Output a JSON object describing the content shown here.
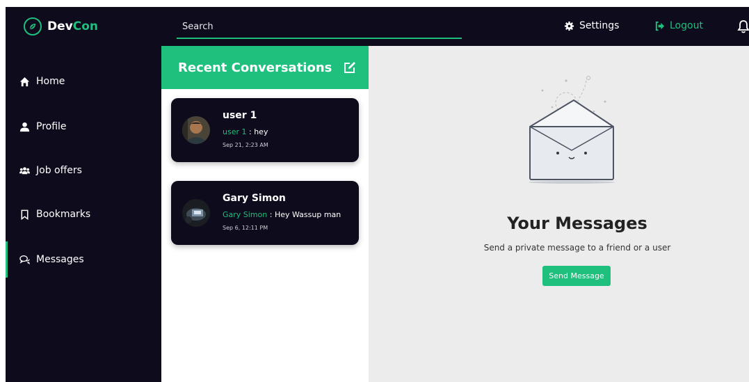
{
  "colors": {
    "dark": "#0e0c1c",
    "accent": "#1fbf7d",
    "panel_bg": "#ececec"
  },
  "brand": {
    "name_part1": "Dev",
    "name_part2": "Con",
    "icon": "leaf-logo-icon"
  },
  "search": {
    "placeholder": "Search"
  },
  "topnav": {
    "settings_label": "Settings",
    "settings_icon": "gear-icon",
    "logout_label": "Logout",
    "logout_icon": "sign-out-icon",
    "bell_icon": "bell-icon"
  },
  "sidebar": {
    "items": [
      {
        "label": "Home",
        "icon": "home-icon"
      },
      {
        "label": "Profile",
        "icon": "user-icon"
      },
      {
        "label": "Job offers",
        "icon": "users-icon"
      },
      {
        "label": "Bookmarks",
        "icon": "bookmark-icon"
      },
      {
        "label": "Messages",
        "icon": "chat-icon",
        "active": true
      }
    ]
  },
  "conversations": {
    "title": "Recent Conversations",
    "items": [
      {
        "name": "user 1",
        "sender": "user 1",
        "separator": " : ",
        "message": "hey",
        "time": "Sep 21, 2:23 AM"
      },
      {
        "name": "Gary Simon",
        "sender": "Gary Simon",
        "separator": " : ",
        "message": "Hey Wassup man",
        "time": "Sep 6, 12:11 PM"
      }
    ]
  },
  "messages_panel": {
    "title": "Your Messages",
    "subtitle": "Send a private message to a friend or a user",
    "button_label": "Send Message"
  }
}
